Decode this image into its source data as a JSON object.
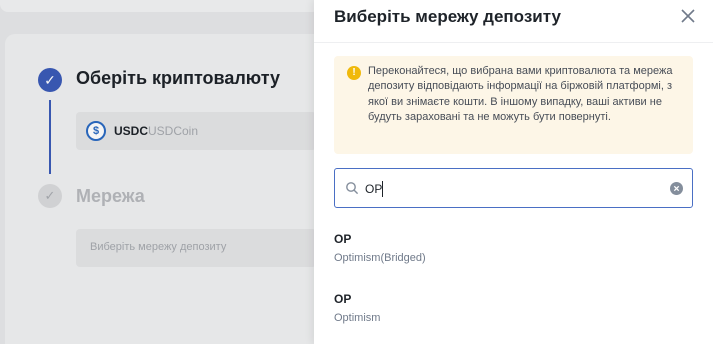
{
  "background": {
    "step1": {
      "title": "Оберіть криптовалюту",
      "check": "✓"
    },
    "selected_coin": {
      "symbol": "USDC",
      "name": "USDCoin",
      "icon": "usdc-icon",
      "icon_glyph": "$"
    },
    "step2": {
      "title": "Мережа",
      "check": "✓"
    },
    "network_placeholder": "Виберіть мережу депозиту"
  },
  "drawer": {
    "title": "Виберіть мережу депозиту",
    "warning": {
      "icon_glyph": "!",
      "text": "Переконайтеся, що вибрана вами криптовалюта та мережа депозиту відповідають інформації на біржовій платформі, з якої ви знімаєте кошти. В іншому випадку, ваші активи не будуть зараховані та не можуть бути повернуті."
    },
    "search": {
      "value": "OP",
      "placeholder": ""
    },
    "networks": [
      {
        "symbol": "OP",
        "name": "Optimism(Bridged)"
      },
      {
        "symbol": "OP",
        "name": "Optimism"
      }
    ]
  },
  "colors": {
    "accent": "#3b5bb8",
    "warning_bg": "#fdf6e7",
    "warning_icon": "#f0b90b",
    "search_border": "#4a6fc4"
  }
}
